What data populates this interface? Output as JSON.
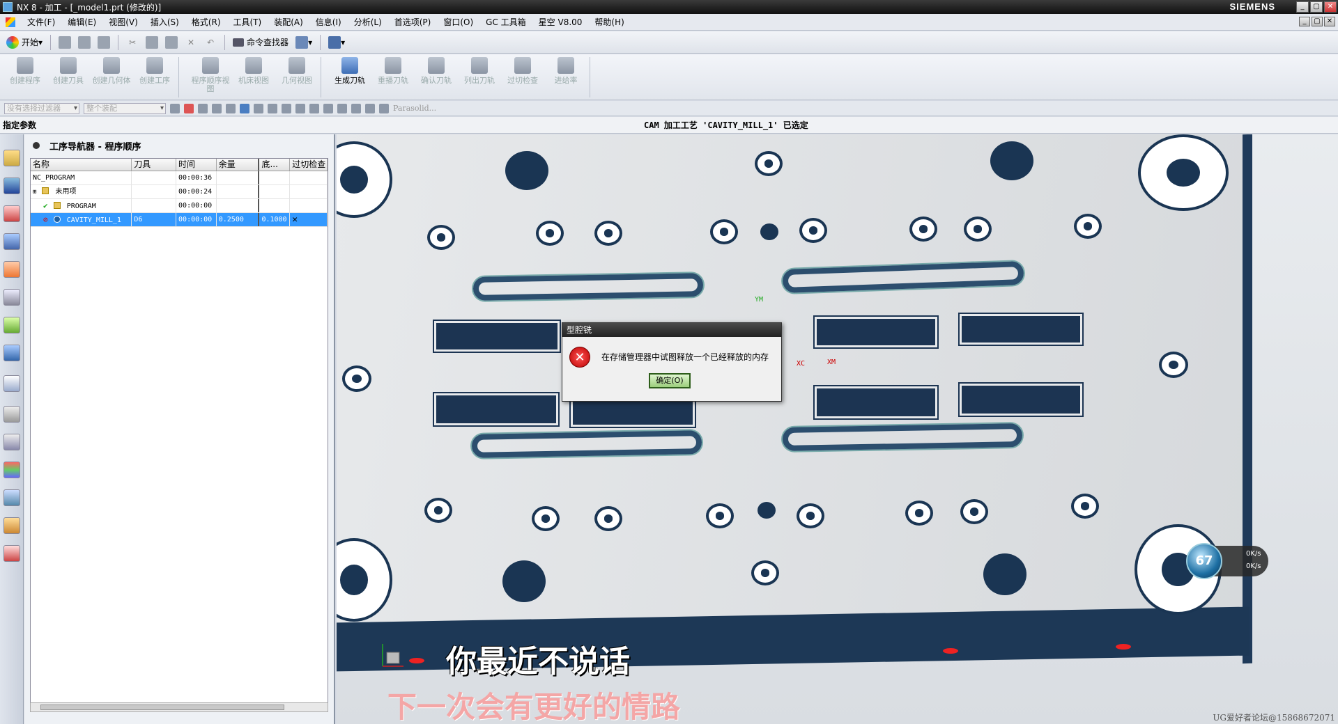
{
  "window": {
    "title": "NX 8 - 加工 - [_model1.prt (修改的)]",
    "brand": "SIEMENS",
    "controls": [
      "_",
      "▢",
      "✕"
    ]
  },
  "menu": [
    "文件(F)",
    "编辑(E)",
    "视图(V)",
    "插入(S)",
    "格式(R)",
    "工具(T)",
    "装配(A)",
    "信息(I)",
    "分析(L)",
    "首选项(P)",
    "窗口(O)",
    "GC 工具箱",
    "星空 V8.00",
    "帮助(H)"
  ],
  "standard_toolbar": {
    "start": "开始",
    "command_finder": "命令查找器"
  },
  "cam_toolbar": {
    "group1": [
      "创建程序",
      "创建刀具",
      "创建几何体",
      "创建工序"
    ],
    "group2": [
      "程序顺序视图",
      "机床视图",
      "几何视图"
    ],
    "group3": [
      "生成刀轨",
      "重播刀轨",
      "确认刀轨",
      "列出刀轨",
      "过切检查",
      "进给率"
    ]
  },
  "selection_bar": {
    "filter": "没有选择过滤器",
    "assembly": "整个装配",
    "kernel": "Parasolid..."
  },
  "cue_line": {
    "prompt": "指定参数",
    "status": "CAM 加工工艺 'CAVITY_MILL_1' 已选定"
  },
  "navigator": {
    "title": "工序导航器 - 程序顺序",
    "columns": [
      "名称",
      "刀具",
      "时间",
      "余量",
      "底...",
      "过切检查"
    ],
    "rows": [
      {
        "name": "NC_PROGRAM",
        "tool": "",
        "time": "00:00:36",
        "stock": "",
        "floor": "",
        "gouge": "",
        "selected": false,
        "indent": 0
      },
      {
        "name": "未用项",
        "tool": "",
        "time": "00:00:24",
        "stock": "",
        "floor": "",
        "gouge": "",
        "selected": false,
        "indent": 1
      },
      {
        "name": "PROGRAM",
        "tool": "",
        "time": "00:00:00",
        "stock": "",
        "floor": "",
        "gouge": "",
        "selected": false,
        "indent": 1
      },
      {
        "name": "CAVITY_MILL_1",
        "tool": "D6",
        "time": "00:00:00",
        "stock": "0.2500",
        "floor": "0.1000",
        "gouge": "✕",
        "selected": true,
        "indent": 1
      }
    ]
  },
  "dialog": {
    "title": "型腔铣",
    "message": "在存储管理器中试图释放一个已经释放的内存",
    "ok": "确定(O)"
  },
  "axes": {
    "ym": "YM",
    "xc": "XC",
    "xm": "XM"
  },
  "net_widget": {
    "percent": "67",
    "up": "0K/s",
    "down": "0K/s"
  },
  "subtitles": {
    "line1": "你最近不说话",
    "line2": "下一次会有更好的情路"
  },
  "watermark": "UG爱好者论坛@15868672071",
  "colors": {
    "selection": "#3399ff",
    "part_blue": "#1a3553",
    "dialog_ok": "#9ccf7c"
  }
}
